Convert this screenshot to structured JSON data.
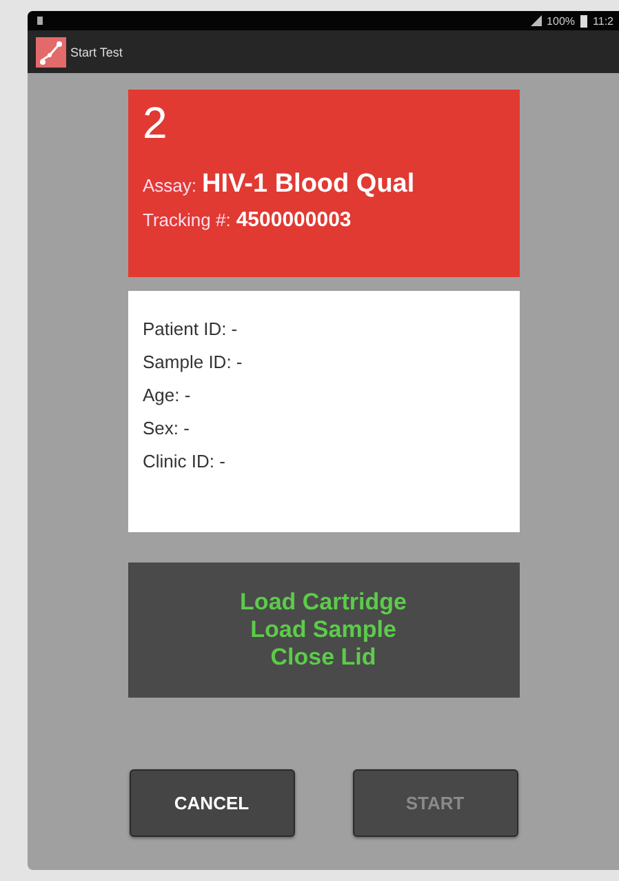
{
  "status_bar": {
    "battery": "100%",
    "time": "11:2"
  },
  "app_bar": {
    "title": "Start Test"
  },
  "test_card": {
    "number": "2",
    "assay_label": "Assay:",
    "assay_value": "HIV-1 Blood Qual",
    "tracking_label": "Tracking #:",
    "tracking_value": "4500000003"
  },
  "patient_info": [
    "Patient ID: -",
    "Sample ID: -",
    "Age: -",
    "Sex: -",
    "Clinic ID: -"
  ],
  "instructions": [
    "Load Cartridge",
    "Load Sample",
    "Close Lid"
  ],
  "buttons": [
    {
      "label": "CANCEL",
      "disabled": false
    },
    {
      "label": "START",
      "disabled": true
    }
  ]
}
